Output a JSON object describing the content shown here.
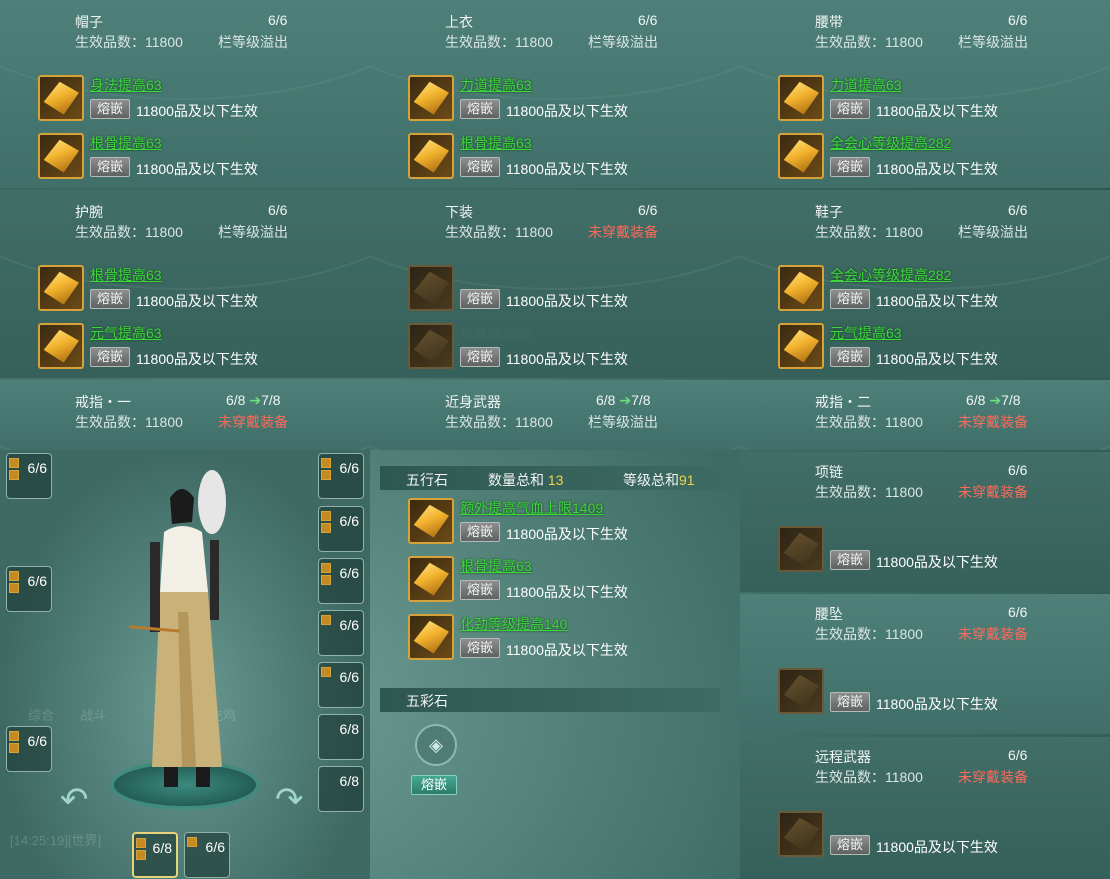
{
  "labels": {
    "quality_prefix": "生效品数：",
    "inlay": "熔嵌",
    "req_suffix": "品及以下生效"
  },
  "slots": {
    "hat": {
      "name": "帽子",
      "count": "6/6",
      "quality": "11800",
      "status": "栏等级溢出",
      "gems": [
        {
          "effect": "身法提高63",
          "req": "11800"
        },
        {
          "effect": "根骨提高63",
          "req": "11800"
        }
      ]
    },
    "top": {
      "name": "上衣",
      "count": "6/6",
      "quality": "11800",
      "status": "栏等级溢出",
      "gems": [
        {
          "effect": "力道提高63",
          "req": "11800"
        },
        {
          "effect": "根骨提高63",
          "req": "11800"
        }
      ]
    },
    "belt": {
      "name": "腰带",
      "count": "6/6",
      "quality": "11800",
      "status": "栏等级溢出",
      "gems": [
        {
          "effect": "力道提高63",
          "req": "11800"
        },
        {
          "effect": "全会心等级提高282",
          "req": "11800"
        }
      ]
    },
    "wrist": {
      "name": "护腕",
      "count": "6/6",
      "quality": "11800",
      "status": "栏等级溢出",
      "gems": [
        {
          "effect": "根骨提高63",
          "req": "11800"
        },
        {
          "effect": "元气提高63",
          "req": "11800"
        }
      ]
    },
    "pants": {
      "name": "下装",
      "count": "6/6",
      "quality": "11800",
      "status": "未穿戴装备",
      "gems": [
        {
          "effect": "",
          "req": "11800"
        },
        {
          "effect": "根骨提高63",
          "req": "11800"
        }
      ]
    },
    "shoes": {
      "name": "鞋子",
      "count": "6/6",
      "quality": "11800",
      "status": "栏等级溢出",
      "gems": [
        {
          "effect": "全会心等级提高282",
          "req": "11800"
        },
        {
          "effect": "元气提高63",
          "req": "11800"
        }
      ]
    },
    "ring1": {
      "name": "戒指・一",
      "count": "6/8",
      "next": "7/8",
      "quality": "11800",
      "status": "未穿戴装备"
    },
    "melee": {
      "name": "近身武器",
      "count": "6/8",
      "next": "7/8",
      "quality": "11800",
      "status": "栏等级溢出"
    },
    "ring2": {
      "name": "戒指・二",
      "count": "6/8",
      "next": "7/8",
      "quality": "11800",
      "status": "未穿戴装备"
    },
    "necklace": {
      "name": "项链",
      "count": "6/6",
      "quality": "11800",
      "status": "未穿戴装备",
      "gem_req": "11800"
    },
    "pendant": {
      "name": "腰坠",
      "count": "6/6",
      "quality": "11800",
      "status": "未穿戴装备",
      "gem_req": "11800"
    },
    "ranged": {
      "name": "远程武器",
      "count": "6/6",
      "quality": "11800",
      "status": "未穿戴装备",
      "gem_req": "11800"
    }
  },
  "wuxing": {
    "title": "五行石",
    "qty_label": "数量总和",
    "qty": "13",
    "lvl_label": "等级总和",
    "lvl": "91",
    "gems": [
      {
        "effect": "额外提高气血上限1409",
        "req": "11800"
      },
      {
        "effect": "根骨提高63",
        "req": "11800"
      },
      {
        "effect": "化劲等级提高140",
        "req": "11800"
      }
    ]
  },
  "wucai": {
    "title": "五彩石",
    "button": "熔嵌"
  },
  "side_slots": {
    "left": [
      "6/6",
      "6/6",
      "6/6"
    ],
    "right": [
      "6/6",
      "6/6",
      "6/6",
      "6/6",
      "6/6",
      "6/8",
      "6/8"
    ],
    "bottom": [
      "6/8",
      "6/6"
    ]
  },
  "colors": {
    "effect_green": "#3dd63d",
    "warn_red": "#ff6a5b",
    "gem_border": "#d8a23a"
  }
}
